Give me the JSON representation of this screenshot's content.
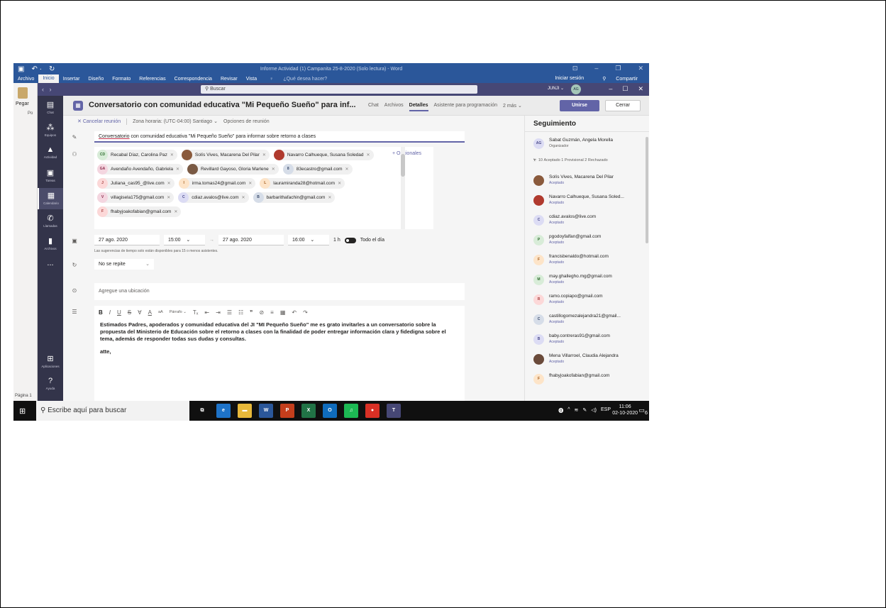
{
  "word": {
    "title": "Informe Actividad (1) Campanita 25-8-2020 (Solo lectura) - Word",
    "tabs": [
      "Archivo",
      "Inicio",
      "Insertar",
      "Diseño",
      "Formato",
      "Referencias",
      "Correspondencia",
      "Revisar",
      "Vista"
    ],
    "tell_me": "¿Qué desea hacer?",
    "sign_in": "Iniciar sesión",
    "share": "Compartir",
    "paste": "Pegar",
    "po": "Po",
    "page": "Página 1"
  },
  "teams": {
    "search_placeholder": "Buscar",
    "org": "JUNJI ⌄",
    "me_initials": "AG",
    "rail": [
      {
        "label": "Chat",
        "icon": "chat-icon",
        "glyph": "▤"
      },
      {
        "label": "Equipos",
        "icon": "teams-icon",
        "glyph": "⁂"
      },
      {
        "label": "Actividad",
        "icon": "bell-icon",
        "glyph": "🔔"
      },
      {
        "label": "Tareas",
        "icon": "tasks-icon",
        "glyph": "▣"
      },
      {
        "label": "Calendario",
        "icon": "calendar-icon",
        "glyph": "▦"
      },
      {
        "label": "Llamadas",
        "icon": "phone-icon",
        "glyph": "✆"
      },
      {
        "label": "Archivos",
        "icon": "files-icon",
        "glyph": "▮"
      },
      {
        "label": "Aplicaciones",
        "icon": "apps-icon",
        "glyph": "⊞"
      },
      {
        "label": "Ayuda",
        "icon": "help-icon",
        "glyph": "?"
      }
    ],
    "more": "...",
    "meeting": {
      "title": "Conversatorio con comunidad educativa \"Mi Pequeño Sueño\" para inf...",
      "tabs": [
        "Chat",
        "Archivos",
        "Detalles",
        "Asistente para programación",
        "2 más ⌄"
      ],
      "selected_tab": "Detalles",
      "join": "Unirse",
      "close": "Cerrar",
      "cancel": "Cancelar reunión",
      "timezone": "Zona horaria: (UTC-04:00) Santiago ⌄",
      "options": "Opciones de reunión",
      "subject_word": "Conversatorio",
      "subject_rest": " con comunidad educativa \"Mi Pequeño Sueño\" para informar sobre retorno a clases",
      "optional": "+ Opcionales",
      "attendees": [
        {
          "name": "Recabal Díaz, Carolina Paz",
          "initials": "CD",
          "color": "#d8ecd8",
          "fg": "#2e6b2e"
        },
        {
          "name": "Solís Vives, Macarena Del Pilar",
          "initials": "",
          "color": "#8a5a3c",
          "fg": "#fff"
        },
        {
          "name": "Navarro Calhueque, Susana Soledad",
          "initials": "",
          "color": "#b03a2e",
          "fg": "#fff"
        },
        {
          "name": "Avendaño Avendaño, Gabriela",
          "initials": "GA",
          "color": "#f4d6e0",
          "fg": "#8a2a4a"
        },
        {
          "name": "Revillard Gayoso, Gloria Marlene",
          "initials": "",
          "color": "#7a5a44",
          "fg": "#fff"
        },
        {
          "name": "83ecastro@gmail.com",
          "initials": "8",
          "color": "#d6dde8",
          "fg": "#3a4a6a"
        },
        {
          "name": "Juliana_cas95_@live.com",
          "initials": "J",
          "color": "#fcd8d8",
          "fg": "#a23a3a"
        },
        {
          "name": "irma.tomas24@gmail.com",
          "initials": "I",
          "color": "#fde4c8",
          "fg": "#a25a1a"
        },
        {
          "name": "lauramiranda28@hotmail.com",
          "initials": "L",
          "color": "#fde4c8",
          "fg": "#a25a1a"
        },
        {
          "name": "villagisela175@gmail.com",
          "initials": "V",
          "color": "#f4d6e0",
          "fg": "#8a2a4a"
        },
        {
          "name": "cdiaz.avalos@live.com",
          "initials": "C",
          "color": "#dcdcf4",
          "fg": "#4a4a8a"
        },
        {
          "name": "barbarithafachin@gmail.com",
          "initials": "B",
          "color": "#d6dde8",
          "fg": "#3a4a6a"
        },
        {
          "name": "fhabyjoakofabian@gmail.com",
          "initials": "F",
          "color": "#fcd8d8",
          "fg": "#a23a3a"
        }
      ],
      "start_date": "27 ago. 2020",
      "start_time": "15:00",
      "end_date": "27 ago. 2020",
      "end_time": "16:00",
      "duration": "1 h",
      "all_day": "Todo el día",
      "hint": "Las sugerencias de tiempo solo están disponibles para 15 o menos asistentes.",
      "repeat": "No se repite",
      "location_placeholder": "Agregue una ubicación",
      "toolbar": {
        "bold": "B",
        "italic": "I",
        "underline": "U",
        "strike": "S",
        "highlight": "∀",
        "font_color": "A",
        "font_size": "aA",
        "paragraph": "Párrafo ⌄",
        "clear": "Tₓ",
        "outdent": "⇤",
        "indent": "⇥",
        "bullets": "☰",
        "numbers": "☷",
        "quote": "❞",
        "link": "⊘",
        "hr": "≡",
        "table": "▦",
        "undo": "↶",
        "redo": "↷"
      },
      "body": "Estimados Padres, apoderados y comunidad educativa del JI \"MI Pequeño Sueño\" me es grato invitarles a un conversatorio sobre la propuesta del Ministerio de Educación sobre el retorno a clases con la finalidad de poder entregar información clara y fidedigna sobre el tema, además de responder todas sus dudas y consultas.",
      "signoff": "atte,"
    },
    "tracking": {
      "title": "Seguimiento",
      "organizer": {
        "name": "Sabat Guzmán, Angela Morella",
        "initials": "AG",
        "role": "Organizador"
      },
      "counts": "10 Aceptado  1 Provisional  2 Rechazado",
      "people": [
        {
          "name": "Solís Vives, Macarena Del Pilar",
          "initials": "",
          "color": "#8a5a3c",
          "fg": "#fff",
          "status": "Aceptado"
        },
        {
          "name": "Navarro Calhueque, Susana Soled...",
          "initials": "",
          "color": "#b03a2e",
          "fg": "#fff",
          "status": "Aceptado"
        },
        {
          "name": "cdiaz.avalos@live.com",
          "initials": "C",
          "color": "#dcdcf4",
          "fg": "#4a4a8a",
          "status": "Aceptado"
        },
        {
          "name": "pgodoyfalfan@gmail.com",
          "initials": "P",
          "color": "#d8ecd8",
          "fg": "#2e6b2e",
          "status": "Aceptado"
        },
        {
          "name": "francisbenaldo@hotmail.com",
          "initials": "F",
          "color": "#fde4c8",
          "fg": "#a25a1a",
          "status": "Aceptado"
        },
        {
          "name": "may.ghallegho.mg@gmail.com",
          "initials": "M",
          "color": "#d8ecd8",
          "fg": "#2e6b2e",
          "status": "Aceptado"
        },
        {
          "name": "ramo.copiapo@gmail.com",
          "initials": "R",
          "color": "#fcd8d8",
          "fg": "#a23a3a",
          "status": "Aceptado"
        },
        {
          "name": "castillogomezalejandra21@gmail...",
          "initials": "C",
          "color": "#d6dde8",
          "fg": "#3a4a6a",
          "status": "Aceptado"
        },
        {
          "name": "baby.contreras91@gmail.com",
          "initials": "B",
          "color": "#dcdcf4",
          "fg": "#4a4a8a",
          "status": "Aceptado"
        },
        {
          "name": "Mena Villarroel, Claudia Alejandra",
          "initials": "",
          "color": "#6a4a3a",
          "fg": "#fff",
          "status": "Aceptado"
        },
        {
          "name": "fhabyjoakofabian@gmail.com",
          "initials": "F",
          "color": "#fde4c8",
          "fg": "#a25a1a",
          "status": ""
        }
      ]
    }
  },
  "taskbar": {
    "search_placeholder": "Escribe aquí para buscar",
    "lang": "ESP",
    "time": "11:06",
    "date": "02-10-2020",
    "notif_count": "6",
    "apps": [
      {
        "name": "task-view",
        "label": "⧉",
        "color": "#101010"
      },
      {
        "name": "edge",
        "label": "e",
        "color": "#1e73c8"
      },
      {
        "name": "file-explorer",
        "label": "▬",
        "color": "#e8b93a"
      },
      {
        "name": "word",
        "label": "W",
        "color": "#2b579a"
      },
      {
        "name": "powerpoint",
        "label": "P",
        "color": "#c43e1c"
      },
      {
        "name": "excel",
        "label": "X",
        "color": "#217346"
      },
      {
        "name": "outlook",
        "label": "O",
        "color": "#0f6cbd"
      },
      {
        "name": "spotify",
        "label": "♫",
        "color": "#1db954"
      },
      {
        "name": "chrome",
        "label": "●",
        "color": "#d93025"
      },
      {
        "name": "teams",
        "label": "T",
        "color": "#464775"
      }
    ]
  }
}
